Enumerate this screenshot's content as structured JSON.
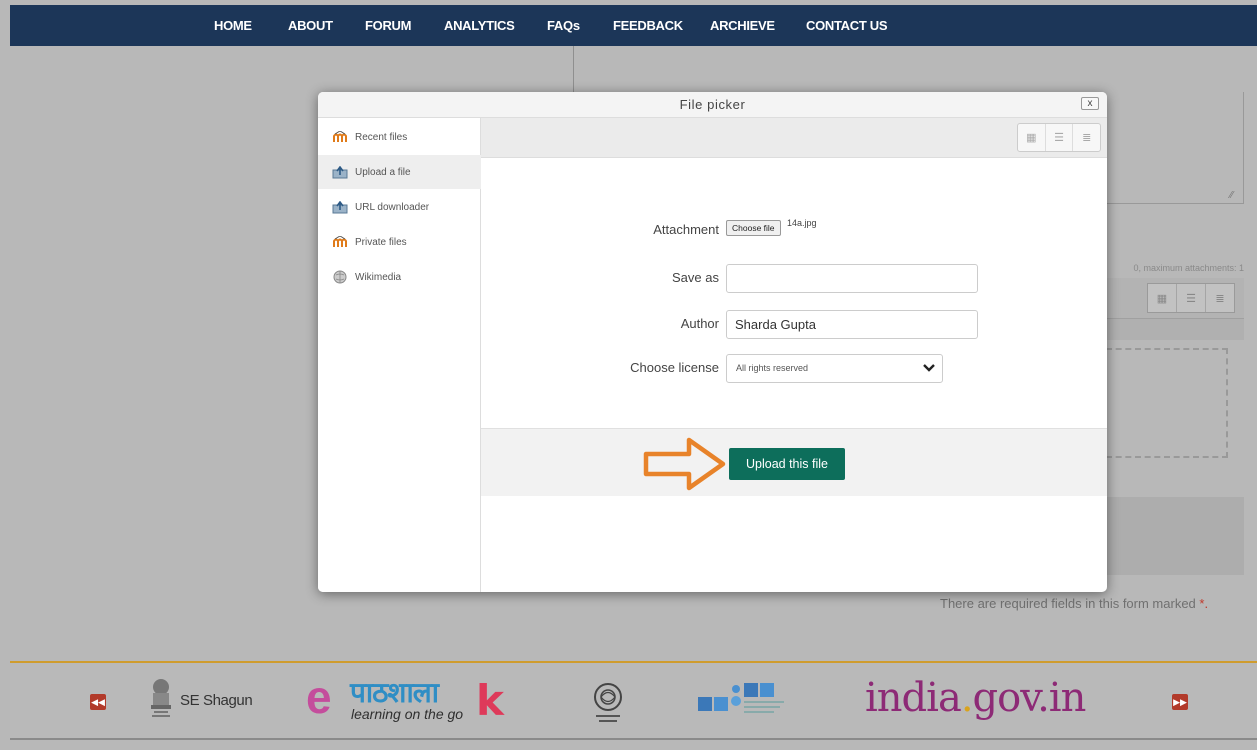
{
  "nav": {
    "items": [
      "HOME",
      "ABOUT",
      "FORUM",
      "ANALYTICS",
      "FAQs",
      "FEEDBACK",
      "ARCHIEVE",
      "CONTACT US"
    ]
  },
  "background": {
    "attachments_note": "0, maximum attachments: 1",
    "required_note": "There are required fields in this form marked",
    "required_star": "*."
  },
  "file_picker": {
    "title": "File picker",
    "close_label": "x",
    "sidebar": [
      {
        "label": "Recent files",
        "icon": "moodle-icon",
        "active": false
      },
      {
        "label": "Upload a file",
        "icon": "upload-icon",
        "active": true
      },
      {
        "label": "URL downloader",
        "icon": "url-download-icon",
        "active": false
      },
      {
        "label": "Private files",
        "icon": "moodle-icon",
        "active": false
      },
      {
        "label": "Wikimedia",
        "icon": "wikimedia-icon",
        "active": false
      }
    ],
    "form": {
      "attachment_label": "Attachment",
      "choose_file_button": "Choose file",
      "chosen_file_name": "14a.jpg",
      "save_as_label": "Save as",
      "save_as_value": "",
      "author_label": "Author",
      "author_value": "Sharda Gupta",
      "license_label": "Choose license",
      "license_value": "All rights reserved"
    },
    "upload_button": "Upload this file"
  },
  "footer": {
    "shagun_label": "SE Shagun",
    "epathshala_big": "e",
    "epathshala_dev": "पाठशाला",
    "epathshala_tagline": "learning on the go",
    "epathshala_k": "k",
    "indiagov_a": "india",
    "indiagov_dot": ".",
    "indiagov_b": "gov.in"
  },
  "colors": {
    "nav_bg": "#1c3658",
    "upload_button": "#0d6e5b",
    "annotation_arrow": "#e8832a",
    "overlay": "#b8b8b8"
  }
}
